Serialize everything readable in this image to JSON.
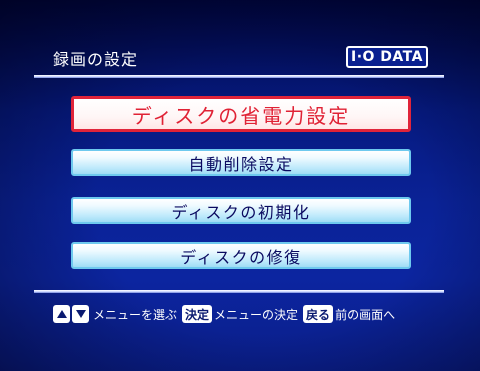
{
  "header": {
    "title": "録画の設定",
    "brand": "I·O DATA"
  },
  "menu": {
    "items": [
      {
        "label": "ディスクの省電力設定",
        "selected": true
      },
      {
        "label": "自動削除設定",
        "selected": false
      },
      {
        "label": "ディスクの初期化",
        "selected": false
      },
      {
        "label": "ディスクの修復",
        "selected": false
      }
    ]
  },
  "footer": {
    "nav_text": "メニューを選ぶ",
    "confirm_key": "決定",
    "confirm_text": "メニューの決定",
    "back_key": "戻る",
    "back_text": "前の画面へ"
  },
  "icons": [
    "arrow-up-icon",
    "arrow-down-icon"
  ],
  "colors": {
    "background": "#0a2296",
    "selected_border": "#e0243a",
    "selected_text": "#e02235",
    "item_text": "#0a0a60",
    "item_border": "#6ec9ee"
  }
}
